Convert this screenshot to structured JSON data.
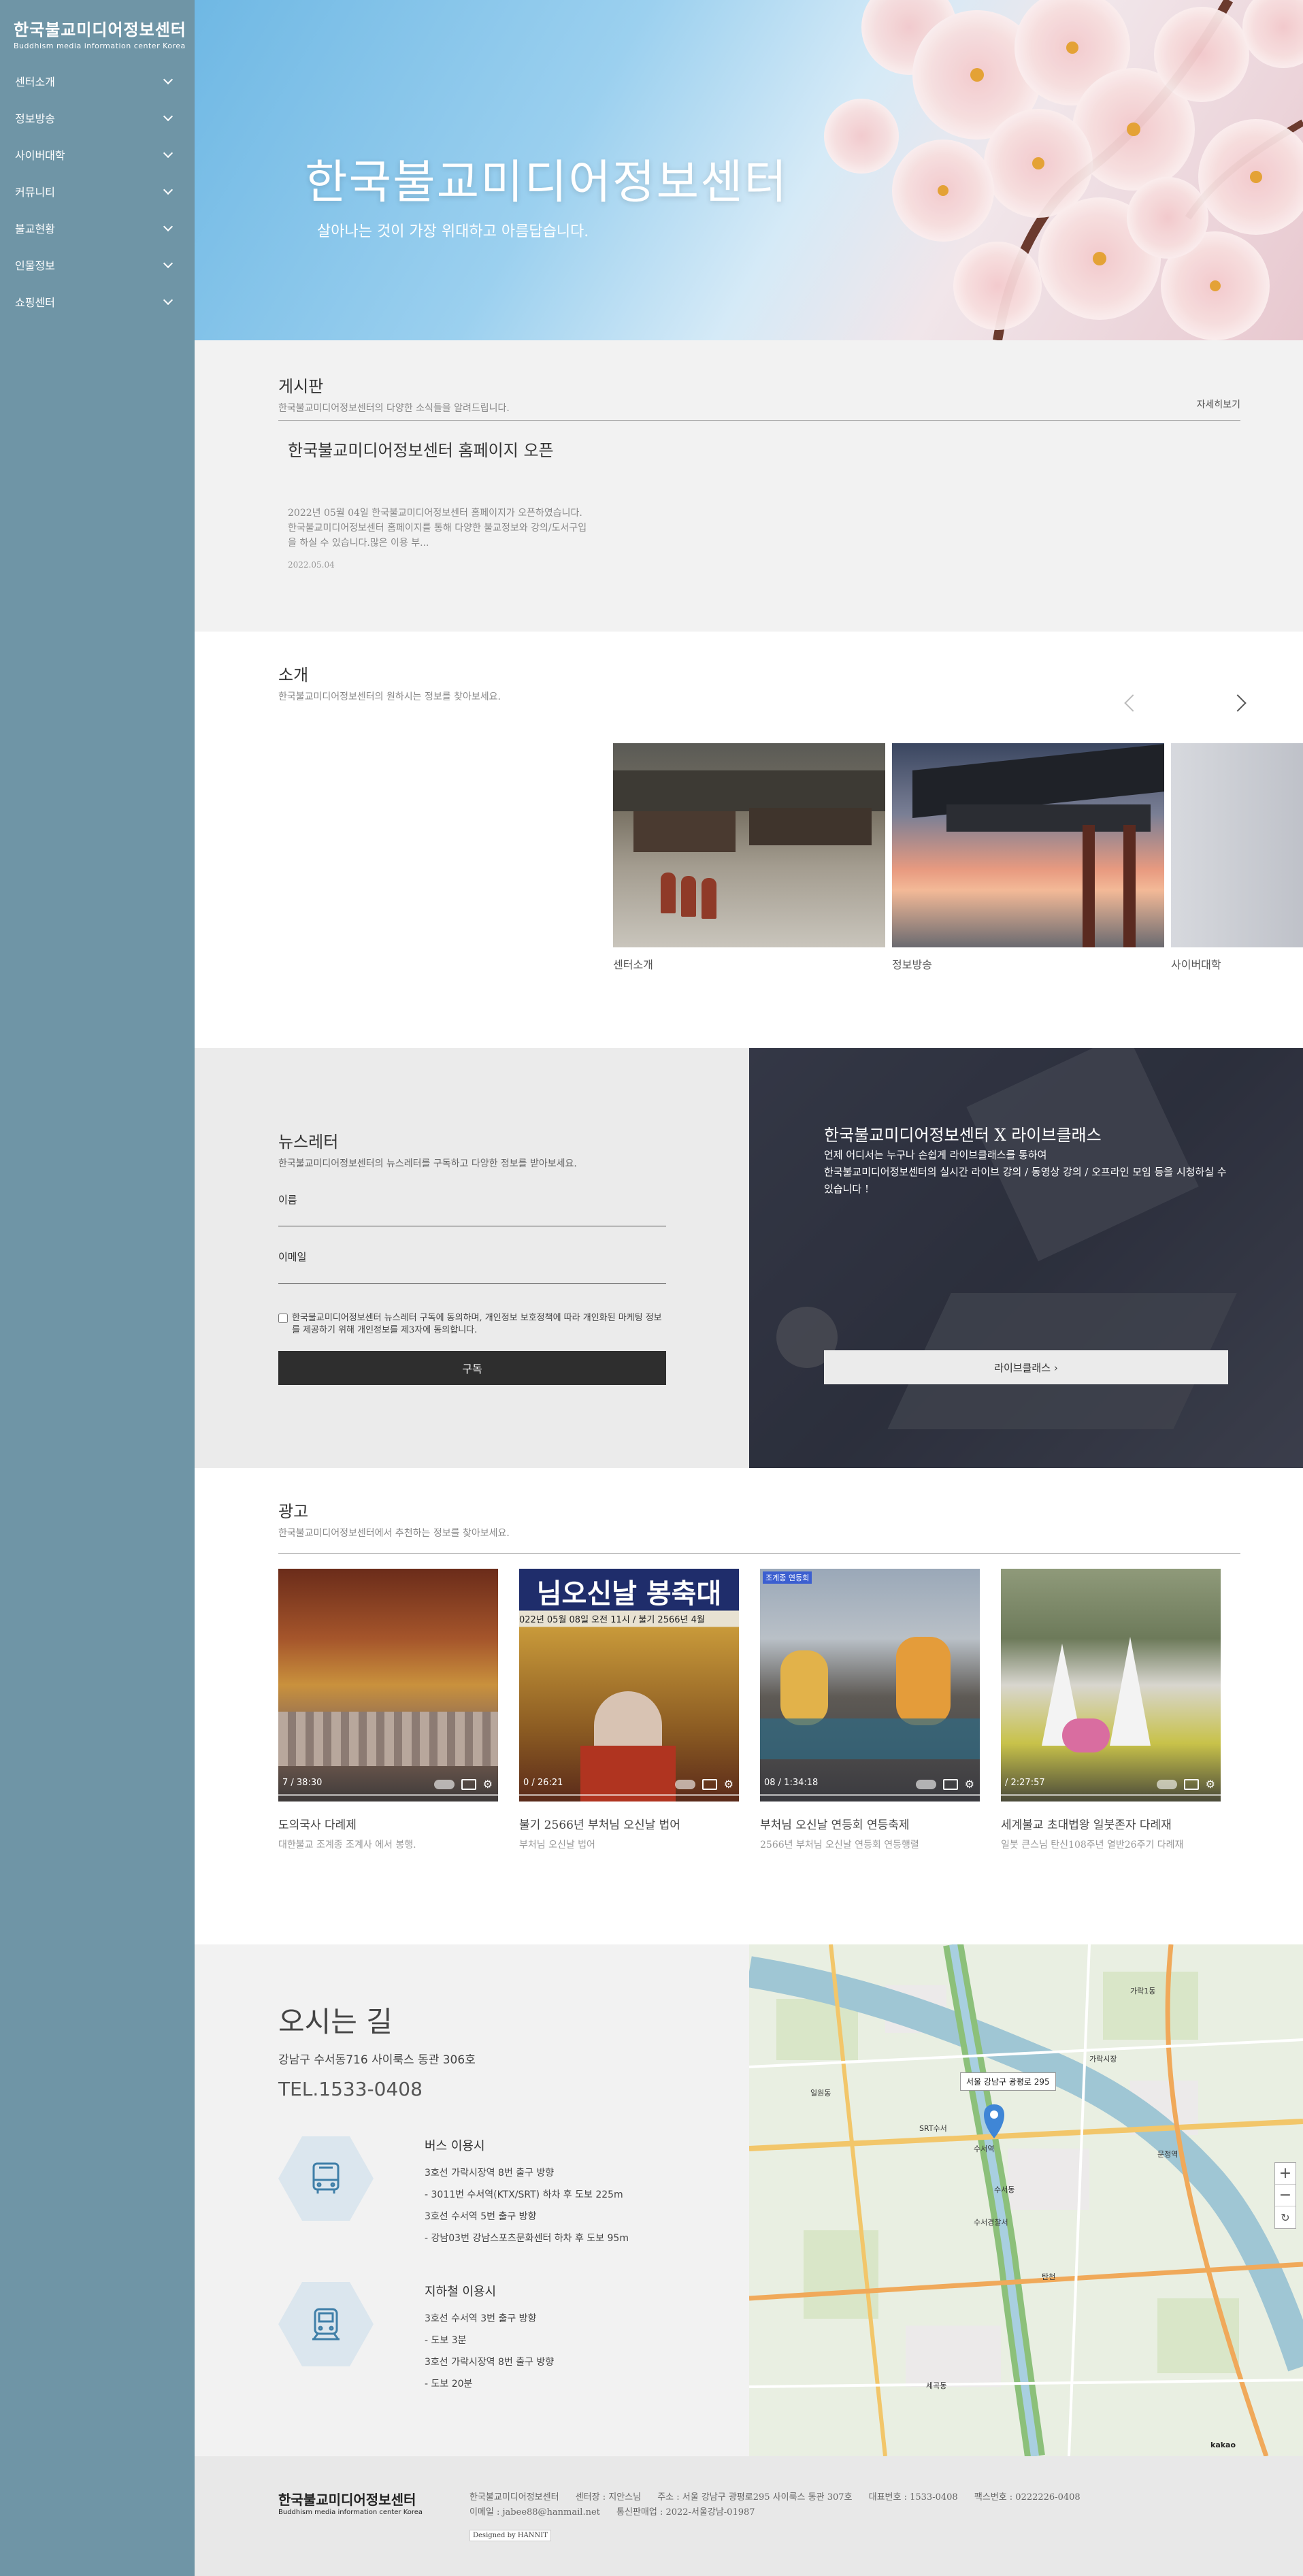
{
  "sidebar": {
    "logo_ko": "한국불교미디어정보센터",
    "logo_en": "Buddhism media information center Korea",
    "items": [
      {
        "label": "센터소개"
      },
      {
        "label": "정보방송"
      },
      {
        "label": "사이버대학"
      },
      {
        "label": "커뮤니티"
      },
      {
        "label": "불교현황"
      },
      {
        "label": "인물정보"
      },
      {
        "label": "쇼핑센터"
      }
    ]
  },
  "hero": {
    "title": "한국불교미디어정보센터",
    "subtitle": "살아나는 것이 가장 위대하고 아름답습니다."
  },
  "board": {
    "title": "게시판",
    "subtitle": "한국불교미디어정보센터의 다양한 소식들을 알려드립니다.",
    "more": "자세히보기",
    "post": {
      "title": "한국불교미디어정보센터 홈페이지 오픈",
      "body": "2022년 05월 04일 한국불교미디어정보센터 홈페이지가 오픈하였습니다. 한국불교미디어정보센터 홈페이지를 통해 다양한 불교정보와 강의/도서구입을 하실 수 있습니다.많은 이용 부...",
      "date": "2022.05.04"
    }
  },
  "intro": {
    "title": "소개",
    "subtitle": "한국불교미디어정보센터의 원하시는 정보를 찾아보세요.",
    "slides": [
      {
        "caption": "센터소개"
      },
      {
        "caption": "정보방송"
      },
      {
        "caption": "사이버대학"
      }
    ]
  },
  "newsletter": {
    "title": "뉴스레터",
    "subtitle": "한국불교미디어정보센터의 뉴스레터를 구독하고 다양한 정보를 받아보세요.",
    "name_label": "이름",
    "email_label": "이메일",
    "agree": "한국불교미디어정보센터 뉴스레터 구독에 동의하며, 개인정보 보호정책에 따라 개인화된 마케팅 정보를 제공하기 위해 개인정보를 제3자에 동의합니다.",
    "submit": "구독"
  },
  "live": {
    "title": "한국불교미디어정보센터 X 라이브클래스",
    "desc1": "언제 어디서는 누구나 손쉽게 라이브클래스를 통하여",
    "desc2": "한국불교미디어정보센터의 실시간 라이브 강의 / 동영상 강의 / 오프라인 모임 등을 시청하실 수 있습니다 !",
    "button": "라이브클래스  ›"
  },
  "ads": {
    "title": "광고",
    "subtitle": "한국불교미디어정보센터에서 추천하는 정보를 찾아보세요.",
    "items": [
      {
        "time": "7 / 38:30",
        "title": "도의국사 다례제",
        "desc": "대한불교 조계종 조계사 에서 봉행."
      },
      {
        "time": "0 / 26:21",
        "banner": "님오신날 봉축대",
        "banner_sub": "022년 05월 08일 오전 11시 / 불기 2566년 4월",
        "title": "불기 2566년 부처님 오신날 법어",
        "desc": "부처님 오신날 법어"
      },
      {
        "time": "08 / 1:34:18",
        "banner": "조계종 연등회",
        "title": "부처님 오신날 연등회 연등축제",
        "desc": "2566년 부처님 오신날 연등회 연등행렬"
      },
      {
        "time": "/ 2:27:57",
        "title": "세계불교 초대법왕 일붓존자 다례재",
        "desc": "일붓 큰스님 탄신108주년 열반26주기 다례재"
      }
    ]
  },
  "directions": {
    "title": "오시는 길",
    "address": "강남구 수서동716 사이룩스 동관 306호",
    "tel": "TEL.1533-0408",
    "bus": {
      "title": "버스 이용시",
      "lines": [
        "3호선 가락시장역 8번 출구 방향",
        "- 3011번 수서역(KTX/SRT) 하차 후 도보 225m",
        "3호선 수서역 5번 출구 방향",
        "- 강남03번 강남스포츠문화센터 하차 후 도보 95m"
      ]
    },
    "subway": {
      "title": "지하철 이용시",
      "lines": [
        "3호선 수서역 3번 출구 방향",
        "- 도보 3분",
        "3호선 가락시장역 8번 출구 방향",
        "- 도보 20분"
      ]
    }
  },
  "map": {
    "pin_label": "서울 강남구 광평로 295",
    "labels": [
      "수서역",
      "SRT수서",
      "수서동",
      "가락시장",
      "수서경찰서",
      "문정역",
      "탄천",
      "일원동",
      "세곡동",
      "가락1동"
    ],
    "brand": "kakao"
  },
  "footer": {
    "logo_ko": "한국불교미디어정보센터",
    "logo_en": "Buddhism media information center Korea",
    "line1": [
      "한국불교미디어정보센터",
      "센터장 : 지안스님",
      "주소 : 서울 강남구 광평로295 사이룩스 동관 307호",
      "대표번호 : 1533-0408",
      "팩스번호 : 0222226-0408"
    ],
    "line2": [
      "이메일 : jabee88@hanmail.net",
      "통신판매업 : 2022-서울강남-01987"
    ],
    "designed": "Designed by HANNIT"
  },
  "colors": {
    "sidebar": "#6f95a6",
    "dark_button": "#2e2e2e",
    "section_gray": "#f2f2f2"
  }
}
